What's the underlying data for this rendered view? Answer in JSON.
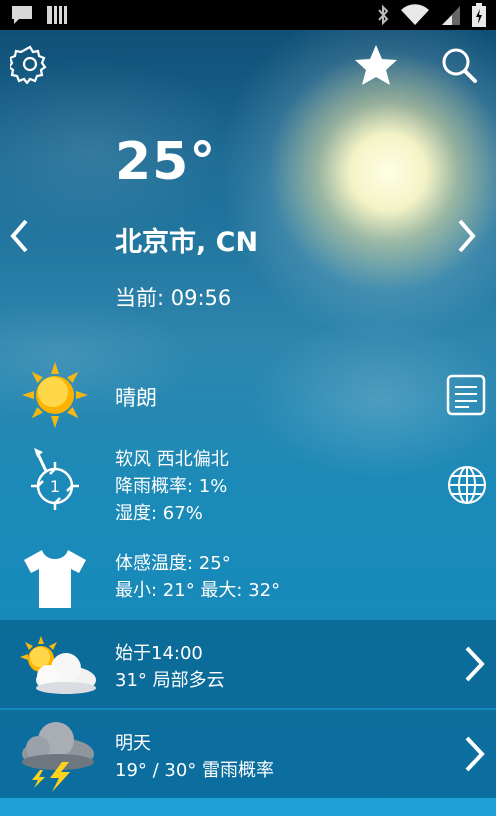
{
  "current": {
    "temperature": "25°",
    "city": "北京市, CN",
    "time": "当前: 09:56",
    "condition": "晴朗",
    "wind": "软风 西北偏北",
    "rain_chance": "降雨概率: 1%",
    "humidity": "湿度: 67%",
    "feels_like": "体感温度: 25°",
    "min_max": "最小: 21° 最大: 32°"
  },
  "forecast": [
    {
      "title": "始于14:00",
      "detail": "31° 局部多云",
      "icon": "partly-cloudy-icon"
    },
    {
      "title": "明天",
      "detail": "19° / 30° 雷雨概率",
      "icon": "thunderstorm-icon"
    }
  ],
  "wind_compass_value": "1",
  "colors": {
    "status_bar": "#000000",
    "sky_top": "#0e4a70",
    "sky_bottom": "#1189c0",
    "sun": "#ffd21e",
    "text": "#ffffff"
  },
  "icons": {
    "settings": "gear-icon",
    "favorite": "star-icon",
    "search": "search-icon",
    "prev": "chevron-left-icon",
    "next": "chevron-right-icon",
    "details": "document-icon",
    "map": "globe-icon",
    "wind": "compass-icon",
    "feels": "tshirt-icon"
  }
}
